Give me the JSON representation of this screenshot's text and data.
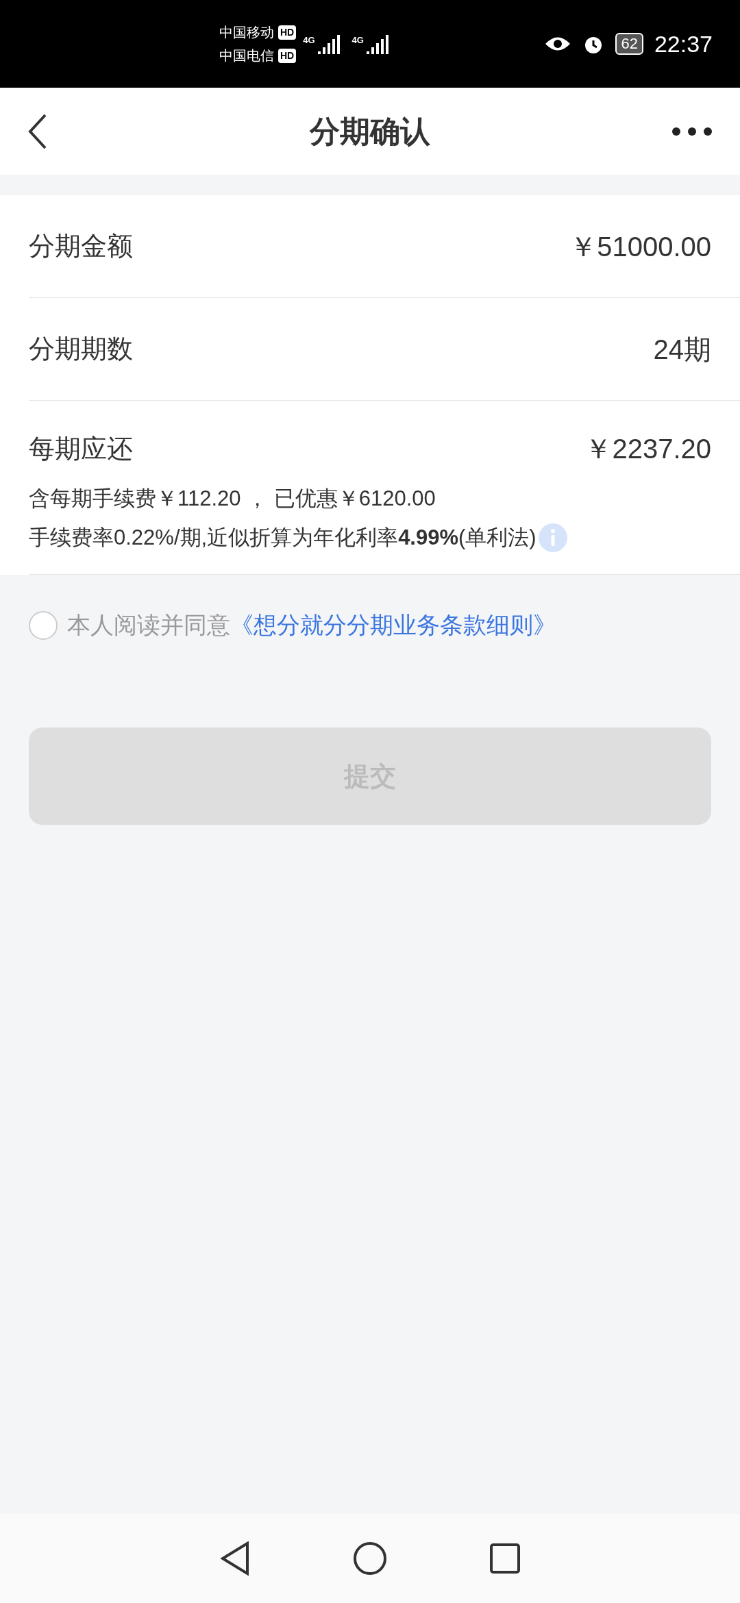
{
  "status_bar": {
    "carrier_1": "中国移动",
    "carrier_2": "中国电信",
    "hd_1": "HD",
    "hd_2": "HD",
    "net_1": "4G",
    "net_2": "4G",
    "battery": "62",
    "time": "22:37"
  },
  "header": {
    "title": "分期确认"
  },
  "rows": [
    {
      "label": "分期金额",
      "value": "￥51000.00"
    },
    {
      "label": "分期期数",
      "value": "24期"
    },
    {
      "label": "每期应还",
      "value": "￥2237.20",
      "details": [
        "含每期手续费￥112.20 ， 已优惠￥6120.00",
        "手续费率0.22%/期,近似折算为年化利率**4.99%**(单利法)"
      ]
    }
  ],
  "agreement": {
    "checked": false,
    "text": "本人阅读并同意",
    "link": "《想分就分分期业务条款细则》"
  },
  "submit": {
    "label": "提交",
    "disabled": true
  }
}
